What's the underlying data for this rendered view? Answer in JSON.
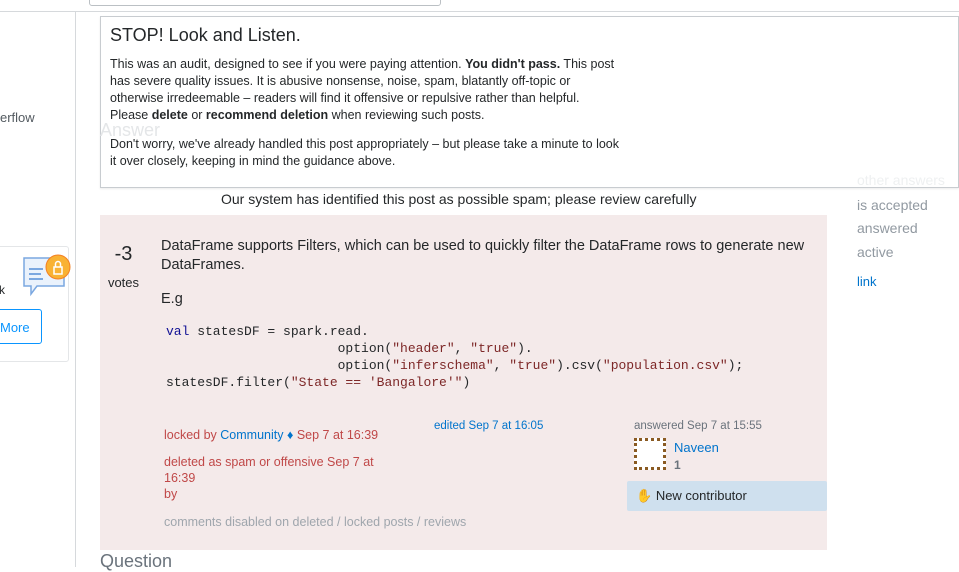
{
  "sidebar": {
    "partial_text": "erflow",
    "promo_partial": "k",
    "promo_button": "More"
  },
  "audit": {
    "title": "STOP! Look and Listen.",
    "p1_a": "This was an audit, designed to see if you were paying attention. ",
    "p1_b": "You didn't pass.",
    "p1_c": " This post has severe quality issues. It is abusive nonsense, noise, spam, blatantly off-topic or otherwise irredeemable – readers will find it offensive or repulsive rather than helpful. Please ",
    "p1_d": "delete",
    "p1_e": " or ",
    "p1_f": "recommend deletion",
    "p1_g": " when reviewing such posts.",
    "p2": "Don't worry, we've already handled this post appropriately – but please take a minute to look it over closely, keeping in mind the guidance above."
  },
  "ghost_heading": "Answer",
  "spam_notice": "Our system has identified this post as possible spam; please review carefully",
  "post": {
    "votes": "-3",
    "votes_label": "votes",
    "text": "DataFrame supports Filters, which can be used to quickly filter the DataFrame rows to generate new DataFrames.",
    "eg": "E.g",
    "code": [
      "val",
      " statesDF = spark.read.\n                      option(",
      "\"header\"",
      ", ",
      "\"true\"",
      ").\n                      option(",
      "\"inferschema\"",
      ", ",
      "\"true\"",
      ").csv(",
      "\"population.csv\"",
      ");\nstatesDF.filter(",
      "\"State == 'Bangalore'\"",
      ")"
    ],
    "locked_prefix": "locked by ",
    "locked_user": "Community ♦",
    "locked_date": " Sep 7 at 16:39",
    "deleted": "deleted as spam or offensive Sep 7 at 16:39",
    "deleted_by": "by",
    "edited": "edited Sep 7 at 16:05",
    "answered": "answered Sep 7 at 15:55",
    "user": "Naveen",
    "rep": "1",
    "new_contributor": "New contributor",
    "comments": "comments disabled on deleted / locked posts / reviews"
  },
  "question_heading": "Question",
  "right": {
    "other": "other answers",
    "accepted": "is accepted",
    "answered": "answered",
    "active": "active",
    "link": "link"
  }
}
